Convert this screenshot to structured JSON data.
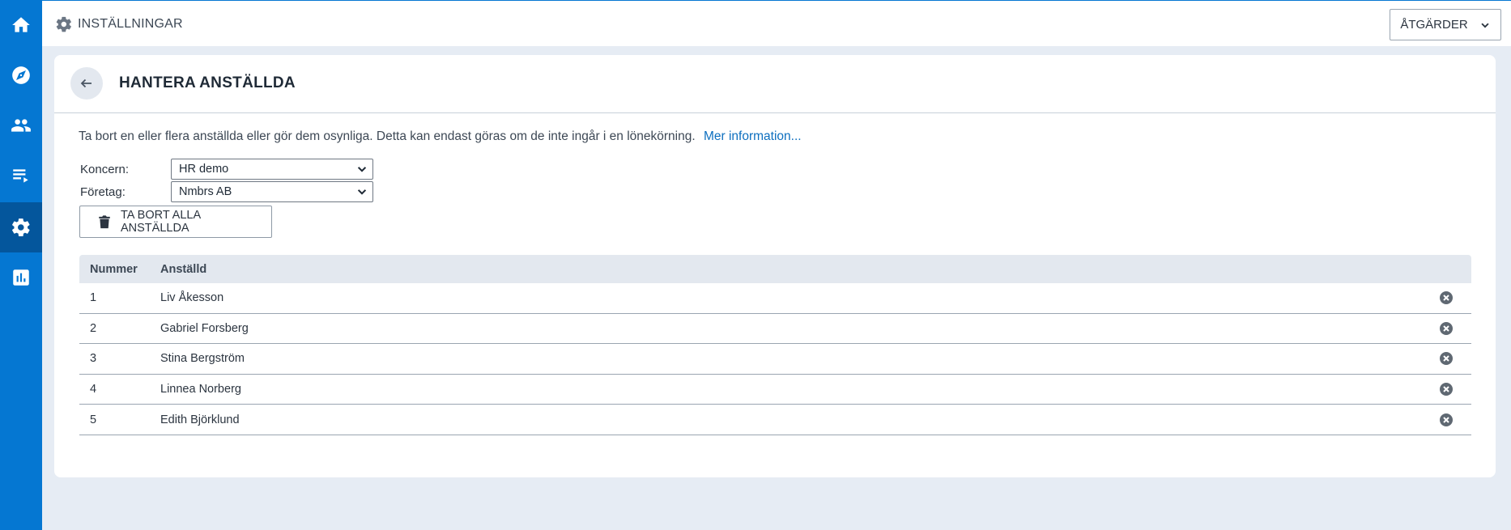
{
  "sidebar": {
    "items": [
      {
        "icon": "home-icon"
      },
      {
        "icon": "compass-icon"
      },
      {
        "icon": "people-icon"
      },
      {
        "icon": "list-icon"
      },
      {
        "icon": "gear-icon",
        "active": true
      },
      {
        "icon": "bar-chart-icon"
      }
    ]
  },
  "topbar": {
    "title": "INSTÄLLNINGAR",
    "actions_label": "ÅTGÄRDER"
  },
  "page": {
    "title": "HANTERA ANSTÄLLDA",
    "description": "Ta bort en eller flera anställda eller gör dem osynliga. Detta kan endast göras om de inte ingår i en lönekörning.",
    "more_info": "Mer information...",
    "concern_label": "Koncern:",
    "concern_value": "HR demo",
    "company_label": "Företag:",
    "company_value": "Nmbrs AB",
    "delete_all_label": "TA BORT ALLA ANSTÄLLDA"
  },
  "table": {
    "headers": {
      "number": "Nummer",
      "employee": "Anställd"
    },
    "rows": [
      {
        "number": "1",
        "name": "Liv Åkesson"
      },
      {
        "number": "2",
        "name": "Gabriel Forsberg"
      },
      {
        "number": "3",
        "name": "Stina Bergström"
      },
      {
        "number": "4",
        "name": "Linnea Norberg"
      },
      {
        "number": "5",
        "name": "Edith Björklund"
      }
    ]
  },
  "colors": {
    "sidebar": "#0577d2",
    "sidebar_active": "#04569c",
    "background": "#e6ecf4",
    "link": "#0d6fbf"
  }
}
